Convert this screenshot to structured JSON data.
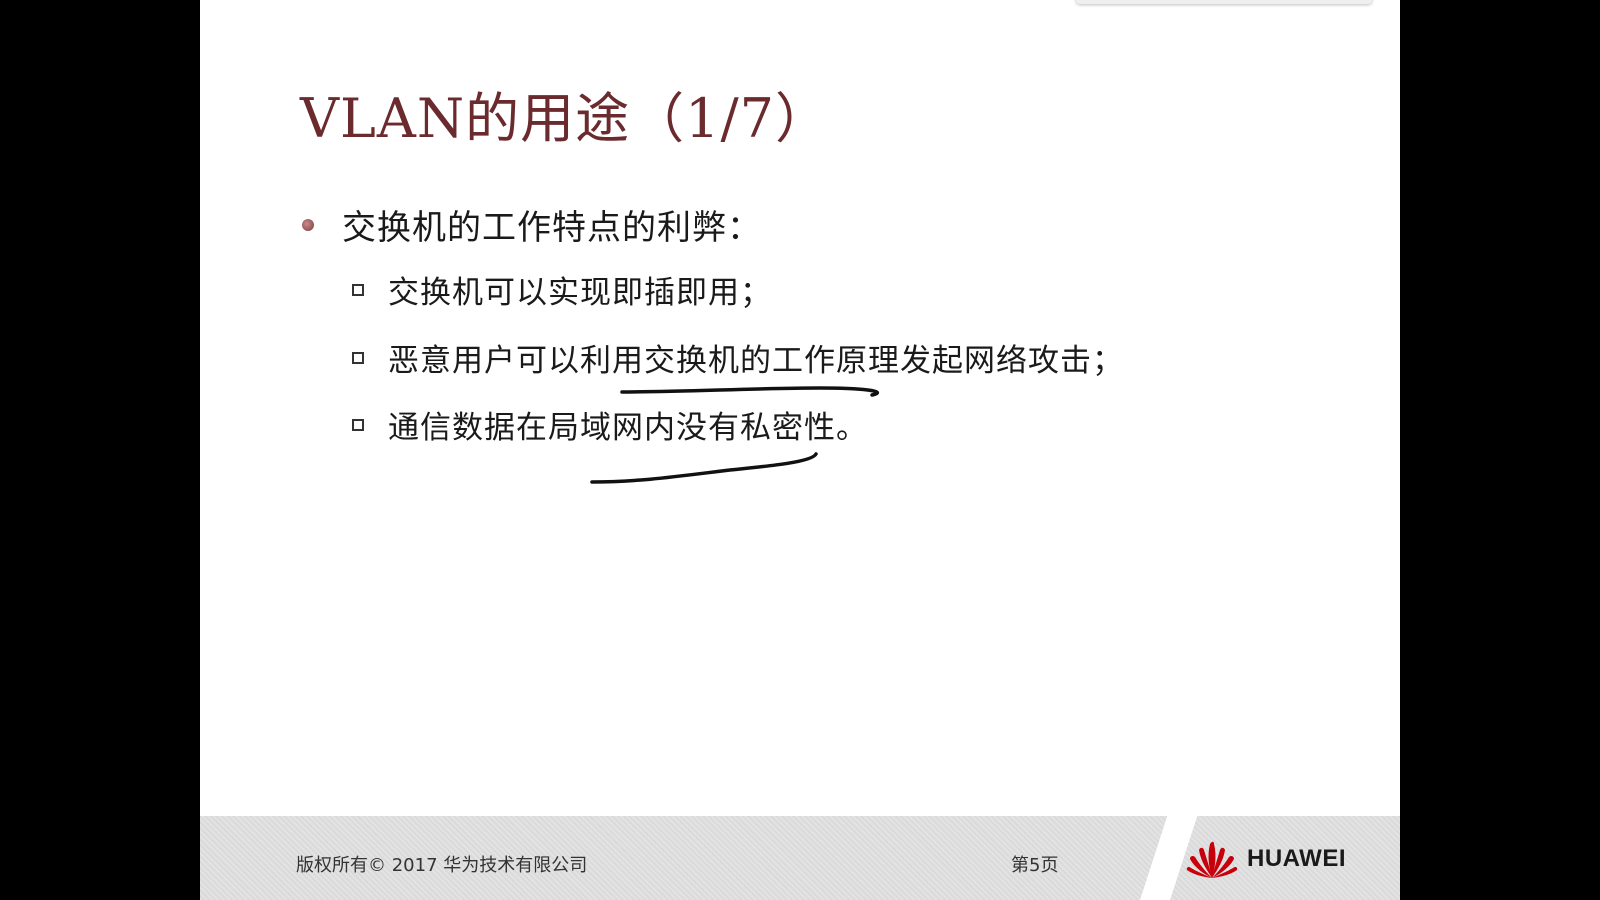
{
  "slide": {
    "title": "VLAN的用途（1/7）",
    "bullets": [
      {
        "text": "交换机的工作特点的利弊：",
        "children": [
          "交换机可以实现即插即用；",
          "恶意用户可以利用交换机的工作原理发起网络攻击；",
          "通信数据在局域网内没有私密性。"
        ]
      }
    ]
  },
  "footer": {
    "copyright": "版权所有© 2017 华为技术有限公司",
    "page": "第5页",
    "logo_text": "HUAWEI"
  },
  "colors": {
    "title": "#6b2b2e",
    "bullet_dot": "#8a4446",
    "logo_red": "#c7000b",
    "footer_bg": "#dedede"
  },
  "icons": {
    "bullet_l1": "round-dot-icon",
    "bullet_l2": "hollow-square-icon",
    "logo": "huawei-petal-logo-icon"
  }
}
